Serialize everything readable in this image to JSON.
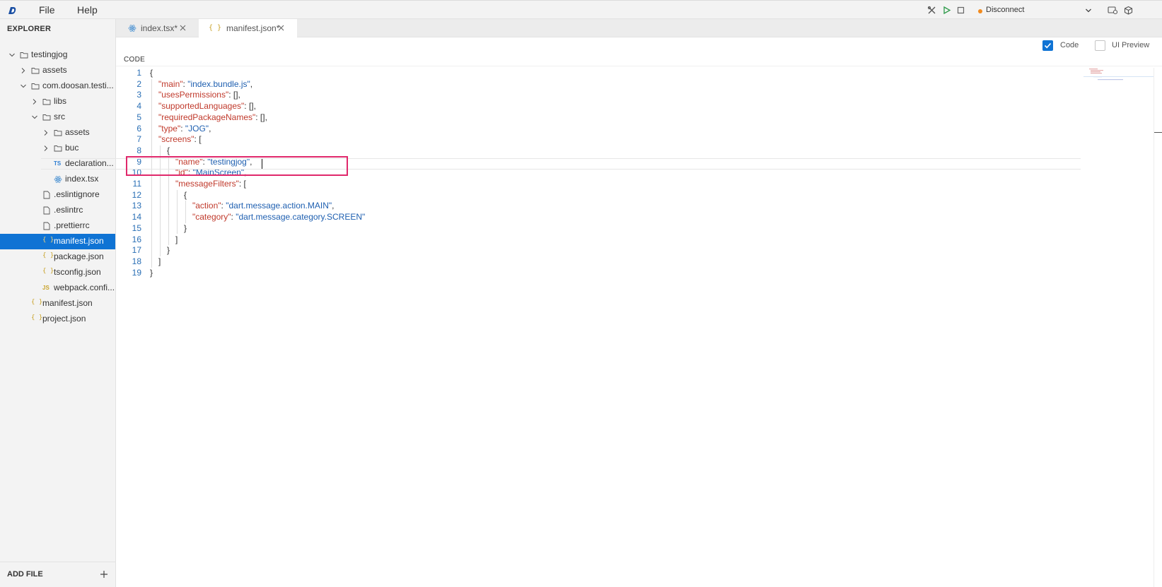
{
  "menu": {
    "file": "File",
    "help": "Help"
  },
  "toolbar": {
    "connection_label": "Disconnect",
    "connection_color": "#f28b1e"
  },
  "sidebar": {
    "title": "EXPLORER",
    "tree": [
      {
        "label": "testingjog",
        "kind": "folder",
        "state": "open",
        "depth": 0
      },
      {
        "label": "assets",
        "kind": "folder",
        "state": "closed",
        "depth": 1
      },
      {
        "label": "com.doosan.testi...",
        "kind": "folder",
        "state": "open",
        "depth": 1
      },
      {
        "label": "libs",
        "kind": "folder",
        "state": "closed",
        "depth": 2
      },
      {
        "label": "src",
        "kind": "folder",
        "state": "open",
        "depth": 2
      },
      {
        "label": "assets",
        "kind": "folder",
        "state": "closed",
        "depth": 3
      },
      {
        "label": "buc",
        "kind": "folder",
        "state": "closed",
        "depth": 3
      },
      {
        "label": "declaration...",
        "kind": "ts",
        "depth": 3
      },
      {
        "label": "index.tsx",
        "kind": "tsx",
        "depth": 3
      },
      {
        "label": ".eslintignore",
        "kind": "file",
        "depth": 2
      },
      {
        "label": ".eslintrc",
        "kind": "file",
        "depth": 2
      },
      {
        "label": ".prettierrc",
        "kind": "file",
        "depth": 2
      },
      {
        "label": "manifest.json",
        "kind": "json",
        "depth": 2,
        "active": true
      },
      {
        "label": "package.json",
        "kind": "json",
        "depth": 2
      },
      {
        "label": "tsconfig.json",
        "kind": "json",
        "depth": 2
      },
      {
        "label": "webpack.confi...",
        "kind": "js",
        "depth": 2
      },
      {
        "label": "manifest.json",
        "kind": "json",
        "depth": 1
      },
      {
        "label": "project.json",
        "kind": "json",
        "depth": 1
      }
    ],
    "add_file_label": "ADD FILE"
  },
  "tabs": [
    {
      "label": "index.tsx*",
      "icon": "react-icon",
      "active": false
    },
    {
      "label": "manifest.json*",
      "icon": "json-icon",
      "active": true
    }
  ],
  "options": {
    "code_label": "Code",
    "code_checked": true,
    "preview_label": "UI Preview",
    "preview_checked": false
  },
  "section_label": "CODE",
  "editor": {
    "highlight_color": "#e0286b",
    "lines": [
      {
        "n": "1",
        "indent": 0,
        "parts": [
          [
            "p",
            "{"
          ]
        ]
      },
      {
        "n": "2",
        "indent": 1,
        "parts": [
          [
            "k",
            "\"main\""
          ],
          [
            "p",
            ": "
          ],
          [
            "s",
            "\"index.bundle.js\""
          ],
          [
            "p",
            ","
          ]
        ]
      },
      {
        "n": "3",
        "indent": 1,
        "parts": [
          [
            "k",
            "\"usesPermissions\""
          ],
          [
            "p",
            ": [],"
          ]
        ]
      },
      {
        "n": "4",
        "indent": 1,
        "parts": [
          [
            "k",
            "\"supportedLanguages\""
          ],
          [
            "p",
            ": [],"
          ]
        ]
      },
      {
        "n": "5",
        "indent": 1,
        "parts": [
          [
            "k",
            "\"requiredPackageNames\""
          ],
          [
            "p",
            ": [],"
          ]
        ]
      },
      {
        "n": "6",
        "indent": 1,
        "parts": [
          [
            "k",
            "\"type\""
          ],
          [
            "p",
            ": "
          ],
          [
            "s",
            "\"JOG\""
          ],
          [
            "p",
            ","
          ]
        ]
      },
      {
        "n": "7",
        "indent": 1,
        "parts": [
          [
            "k",
            "\"screens\""
          ],
          [
            "p",
            ": ["
          ]
        ]
      },
      {
        "n": "8",
        "indent": 2,
        "parts": [
          [
            "p",
            "{"
          ]
        ]
      },
      {
        "n": "9",
        "indent": 3,
        "parts": [
          [
            "k",
            "\"name\""
          ],
          [
            "p",
            ": "
          ],
          [
            "s",
            "\"testingjog\""
          ],
          [
            "p",
            ","
          ]
        ]
      },
      {
        "n": "10",
        "indent": 3,
        "parts": [
          [
            "k",
            "\"id\""
          ],
          [
            "p",
            ": "
          ],
          [
            "s",
            "\"MainScreen\""
          ],
          [
            "p",
            ","
          ]
        ]
      },
      {
        "n": "11",
        "indent": 3,
        "parts": [
          [
            "k",
            "\"messageFilters\""
          ],
          [
            "p",
            ": ["
          ]
        ]
      },
      {
        "n": "12",
        "indent": 4,
        "parts": [
          [
            "p",
            "{"
          ]
        ]
      },
      {
        "n": "13",
        "indent": 5,
        "parts": [
          [
            "k",
            "\"action\""
          ],
          [
            "p",
            ": "
          ],
          [
            "s",
            "\"dart.message.action.MAIN\""
          ],
          [
            "p",
            ","
          ]
        ]
      },
      {
        "n": "14",
        "indent": 5,
        "parts": [
          [
            "k",
            "\"category\""
          ],
          [
            "p",
            ": "
          ],
          [
            "s",
            "\"dart.message.category.SCREEN\""
          ]
        ]
      },
      {
        "n": "15",
        "indent": 4,
        "parts": [
          [
            "p",
            "}"
          ]
        ]
      },
      {
        "n": "16",
        "indent": 3,
        "parts": [
          [
            "p",
            "]"
          ]
        ]
      },
      {
        "n": "17",
        "indent": 2,
        "parts": [
          [
            "p",
            "}"
          ]
        ]
      },
      {
        "n": "18",
        "indent": 1,
        "parts": [
          [
            "p",
            "]"
          ]
        ]
      },
      {
        "n": "19",
        "indent": 0,
        "parts": [
          [
            "p",
            "}"
          ]
        ]
      }
    ]
  }
}
